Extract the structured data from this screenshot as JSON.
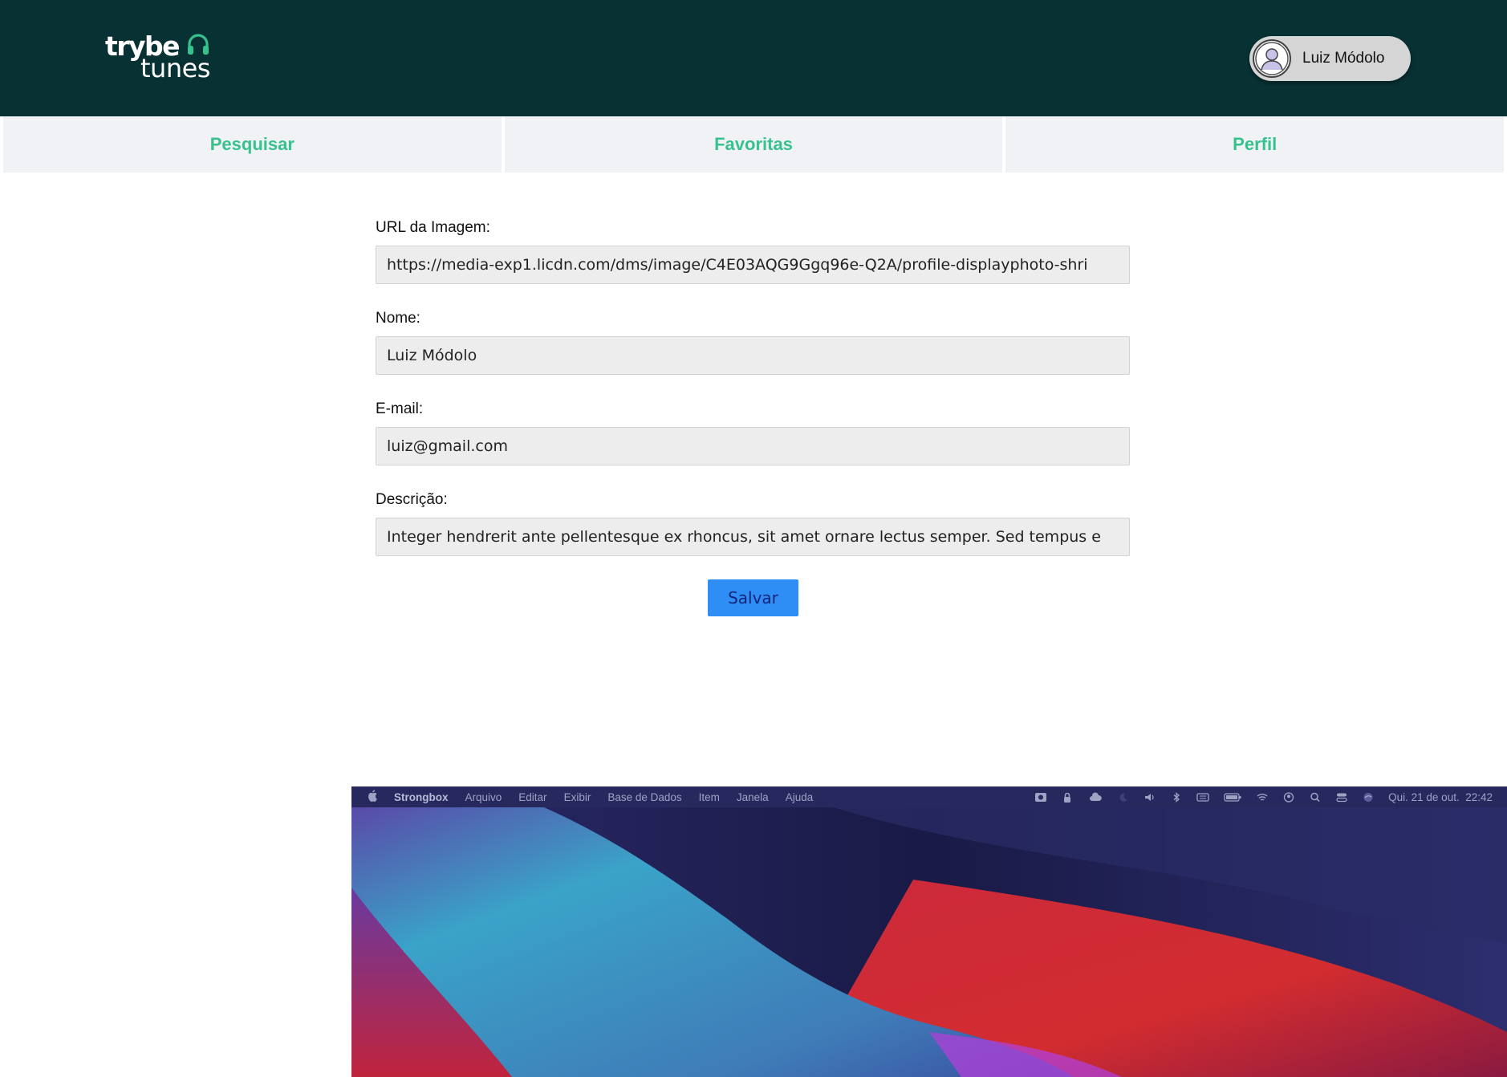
{
  "app": {
    "logo": {
      "line1": "trybe",
      "line2": "tunes"
    },
    "user": {
      "name": "Luiz Módolo"
    },
    "nav": [
      {
        "label": "Pesquisar"
      },
      {
        "label": "Favoritas"
      },
      {
        "label": "Perfil"
      }
    ],
    "form": {
      "image_url_label": "URL da Imagem:",
      "image_url_value": "https://media-exp1.licdn.com/dms/image/C4E03AQG9Ggq96e-Q2A/profile-displayphoto-shri",
      "name_label": "Nome:",
      "name_value": "Luiz Módolo",
      "email_label": "E-mail:",
      "email_value": "luiz@gmail.com",
      "description_label": "Descrição:",
      "description_value": "Integer hendrerit ante pellentesque ex rhoncus, sit amet ornare lectus semper. Sed tempus e",
      "save_label": "Salvar"
    },
    "colors": {
      "header_bg": "#083133",
      "accent_green": "#36c18d",
      "nav_bg": "#f0f2f5",
      "button_bg": "#2e8ef5"
    }
  },
  "os": {
    "menubar": {
      "apple_icon": "apple-icon",
      "active_app": "Strongbox",
      "menus": [
        "Arquivo",
        "Editar",
        "Exibir",
        "Base de Dados",
        "Item",
        "Janela",
        "Ajuda"
      ],
      "clock": "Qui. 21 de out.  22:42",
      "status_icons": [
        "camera-icon",
        "lock-icon",
        "cloud-icon",
        "moon-icon",
        "volume-icon",
        "bluetooth-icon",
        "keyboard-icon",
        "battery-icon",
        "wifi-icon",
        "user-icon",
        "search-icon",
        "control-center-icon",
        "siri-icon"
      ]
    }
  }
}
